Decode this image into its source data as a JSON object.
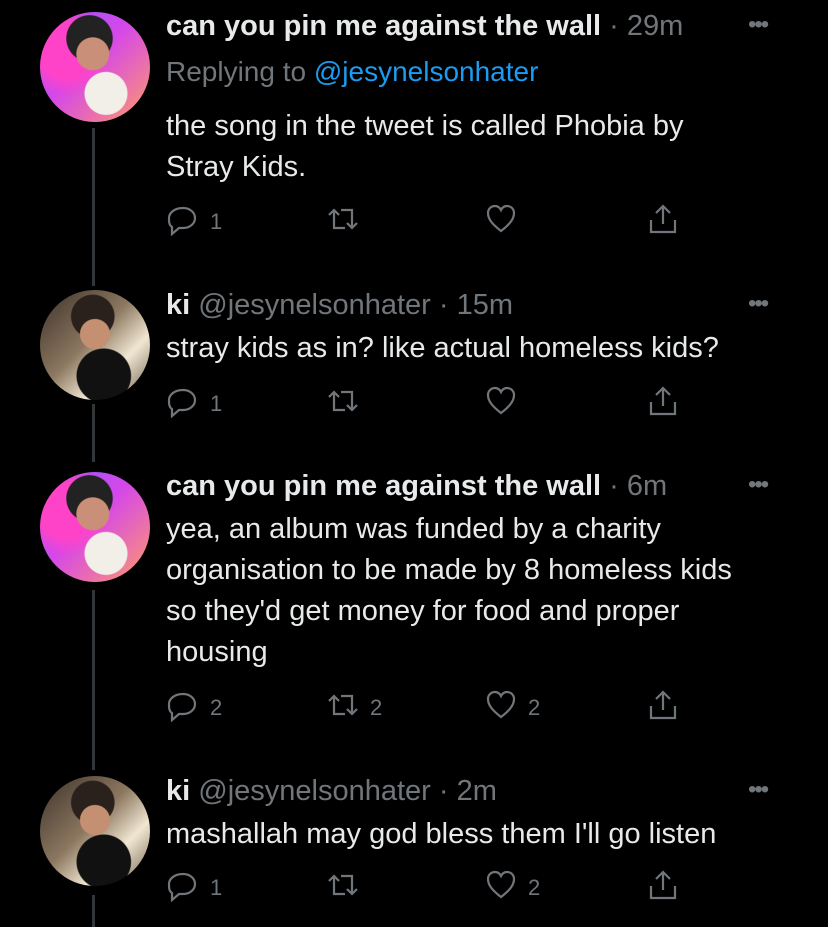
{
  "tweets": [
    {
      "name": "can you pin me against the wall",
      "handle": "",
      "time": "· 29m",
      "replying_prefix": "Replying to ",
      "replying_handle": "@jesynelsonhater",
      "text": "the song in the tweet is called Phobia by Stray Kids.",
      "reply_count": "1",
      "retweet_count": "",
      "like_count": ""
    },
    {
      "name": "ki",
      "handle": "@jesynelsonhater",
      "time": "· 15m",
      "text": "stray kids as in? like actual homeless kids?",
      "reply_count": "1",
      "retweet_count": "",
      "like_count": ""
    },
    {
      "name": "can you pin me against the wall",
      "handle": "",
      "time": "· 6m",
      "text": "yea, an album was funded by a charity organisation to be made by 8 homeless kids so they'd get money for food and proper housing",
      "reply_count": "2",
      "retweet_count": "2",
      "like_count": "2"
    },
    {
      "name": "ki",
      "handle": "@jesynelsonhater",
      "time": "· 2m",
      "text": "mashallah may god bless them I'll go listen",
      "reply_count": "1",
      "retweet_count": "",
      "like_count": "2"
    }
  ],
  "icons": {
    "more": "more-icon",
    "reply": "reply-icon",
    "retweet": "retweet-icon",
    "like": "like-icon",
    "share": "share-icon"
  },
  "colors": {
    "background": "#000000",
    "text": "#e7e9ea",
    "secondary": "#71767b",
    "link": "#1d9bf0",
    "thread_line": "#333639"
  }
}
